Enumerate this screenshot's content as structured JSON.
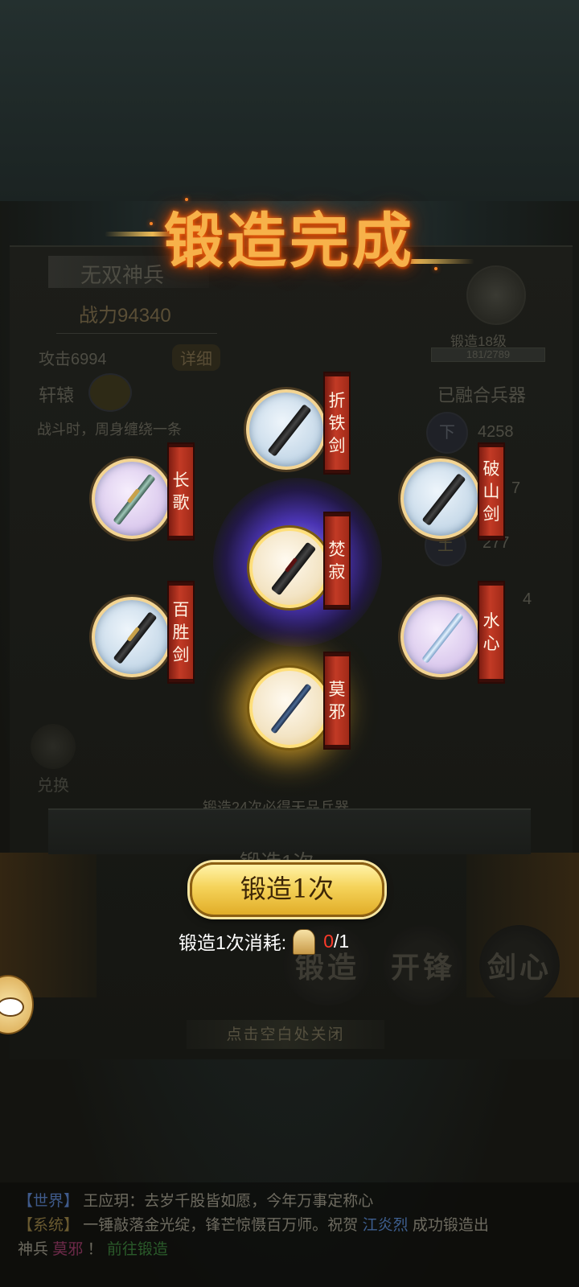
{
  "background": {
    "weapon_name": "无双神兵",
    "power": "战力94340",
    "attack": "攻击6994",
    "detail_button": "详细",
    "weapon_type": "轩辕",
    "skill_desc": "战斗时，周身缠绕一条",
    "forge_level": "锻造18级",
    "forge_progress": "181/2789",
    "fused_label": "已融合兵器",
    "stat_row_1_icon": "下",
    "stat_row_1_value": "4258",
    "stat_row_2_value": "7",
    "stat_row_3_icon": "土",
    "stat_row_3_value": "277",
    "stat_row_4_value": "4",
    "exchange_label": "兑换",
    "guarantee_hint": "锻造24次必得天品兵器",
    "forge_button_bg": "锻造1次",
    "tab_forge": "锻造",
    "tab_sharpen": "开锋",
    "tab_sword_heart": "剑心",
    "close_hint": "点击空白处关闭"
  },
  "overlay": {
    "title": "锻造完成",
    "weapons": [
      {
        "name": "折铁剑",
        "chars": [
          "折",
          "铁",
          "剑"
        ],
        "quality": "blue"
      },
      {
        "name": "长歌",
        "chars": [
          "长",
          "歌"
        ],
        "quality": "purple"
      },
      {
        "name": "破山剑",
        "chars": [
          "破",
          "山",
          "剑"
        ],
        "quality": "blue"
      },
      {
        "name": "焚寂",
        "chars": [
          "焚",
          "寂"
        ],
        "quality": "violet-glow"
      },
      {
        "name": "百胜剑",
        "chars": [
          "百",
          "胜",
          "剑"
        ],
        "quality": "blue"
      },
      {
        "name": "水心",
        "chars": [
          "水",
          "心"
        ],
        "quality": "purple"
      },
      {
        "name": "莫邪",
        "chars": [
          "莫",
          "邪"
        ],
        "quality": "gold"
      }
    ],
    "forge_button": "锻造1次",
    "cost_label": "锻造1次消耗:",
    "cost_have": "0",
    "cost_sep": "/",
    "cost_need": "1"
  },
  "chat": {
    "line1_tag": "【世界】",
    "line1_text": "王应玥：去岁千股皆如愿，今年万事定称心",
    "line2_tag": "【系统】",
    "line2_text_a": "一锤敲落金光绽，锋芒惊慑百万师。祝贺",
    "line2_name": "江炎烈",
    "line2_text_b": "成功锻造出",
    "line3_text_a": "神兵",
    "line3_item": "莫邪",
    "line3_text_b": "！",
    "line3_link": "前往锻造"
  },
  "colors": {
    "title_glow": "#ff6a10",
    "banner_red": "#c23a25",
    "button_gold": "#f5d35a",
    "cost_red": "#ff3a2a"
  }
}
